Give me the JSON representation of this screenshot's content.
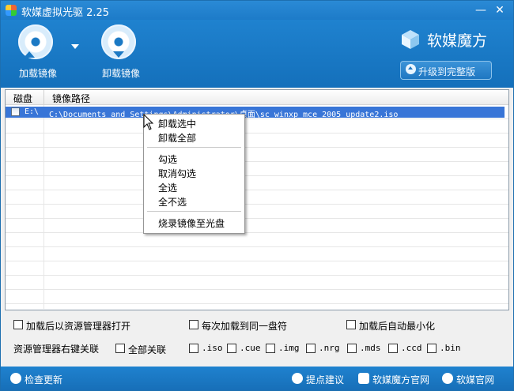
{
  "window": {
    "title": "软媒虚拟光驱 2.25",
    "minimize_glyph": "—",
    "close_glyph": "✕"
  },
  "toolbar": {
    "mount_label": "加载镜像",
    "unmount_label": "卸载镜像"
  },
  "brand": {
    "name": "软媒魔方",
    "upgrade_label": "升级到完整版"
  },
  "list": {
    "columns": [
      "磁盘",
      "镜像路径"
    ],
    "rows": [
      {
        "drive": "E:\\",
        "path": "C:\\Documents and Settings\\Administrator\\桌面\\sc_winxp_mce_2005_update2.iso",
        "checked": false,
        "selected": true
      }
    ]
  },
  "context_menu": {
    "items": [
      "卸载选中",
      "卸载全部",
      "勾选",
      "取消勾选",
      "全选",
      "全不选",
      "烧录镜像至光盘"
    ]
  },
  "options": {
    "open_in_explorer": "加载后以资源管理器打开",
    "same_drive": "每次加载到同一盘符",
    "auto_minimize": "加载后自动最小化"
  },
  "associations": {
    "label": "资源管理器右键关联",
    "all_label": "全部关联",
    "types": [
      ".iso",
      ".cue",
      ".img",
      ".nrg",
      ".mds",
      ".ccd",
      ".bin"
    ]
  },
  "statusbar": {
    "check_update": "检查更新",
    "feedback": "提点建议",
    "mofang_site": "软媒魔方官网",
    "ruanmei_site": "软媒官网"
  },
  "colors": {
    "chrome_blue": "#1b79c4",
    "selection": "#3875d7"
  }
}
